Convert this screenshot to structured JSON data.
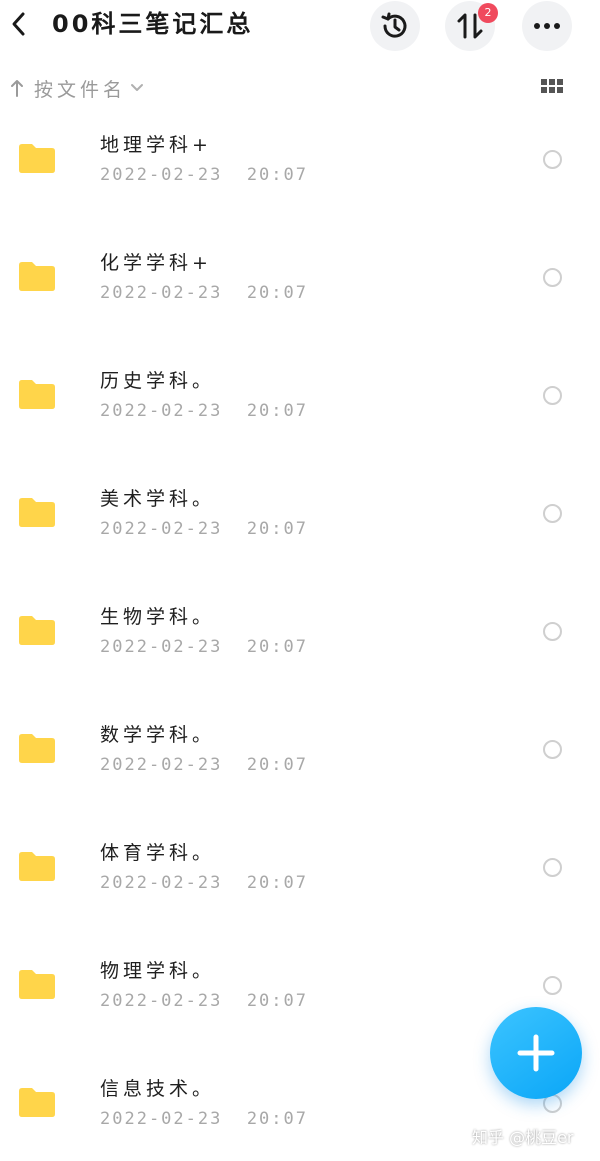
{
  "header": {
    "title": "00科三笔记汇总",
    "back_icon": "chevron-left-icon",
    "history_icon": "history-icon",
    "transfer_icon": "transfer-icon",
    "transfer_badge": "2",
    "more_icon": "more-horizontal-icon"
  },
  "sortbar": {
    "label": "按文件名",
    "arrow_icon": "arrow-up-icon",
    "dropdown_icon": "chevron-down-icon",
    "view_icon": "grid-view-icon"
  },
  "colors": {
    "folder": "#ffd54a",
    "accent": "#14aef8",
    "badge": "#f04a5d"
  },
  "files": [
    {
      "name": "地理学科+",
      "date": "2022-02-23  20:07"
    },
    {
      "name": "化学学科+",
      "date": "2022-02-23  20:07"
    },
    {
      "name": "历史学科。",
      "date": "2022-02-23  20:07"
    },
    {
      "name": "美术学科。",
      "date": "2022-02-23  20:07"
    },
    {
      "name": "生物学科。",
      "date": "2022-02-23  20:07"
    },
    {
      "name": "数学学科。",
      "date": "2022-02-23  20:07"
    },
    {
      "name": "体育学科。",
      "date": "2022-02-23  20:07"
    },
    {
      "name": "物理学科。",
      "date": "2022-02-23  20:07"
    },
    {
      "name": "信息技术。",
      "date": "2022-02-23  20:07"
    }
  ],
  "fab": {
    "icon": "plus-icon"
  },
  "watermark": "知乎 @桃豆er"
}
